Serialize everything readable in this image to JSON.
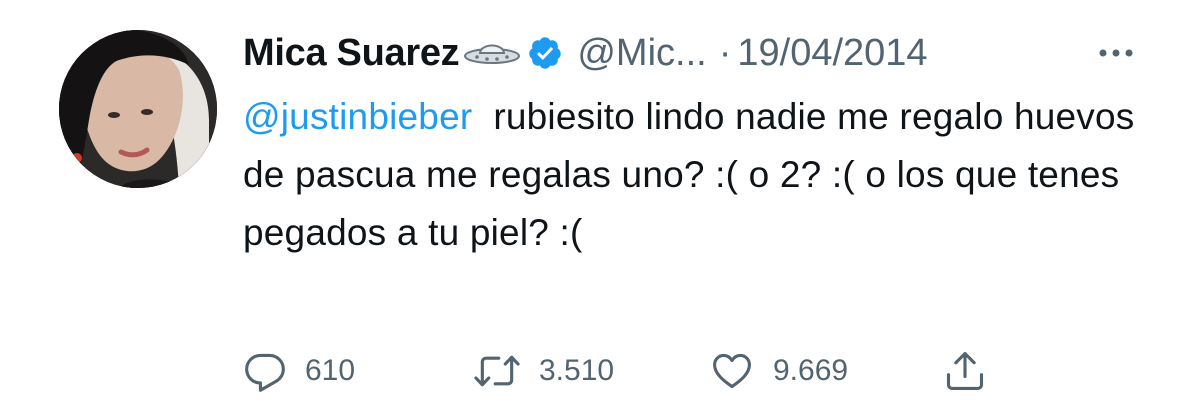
{
  "tweet": {
    "author": {
      "display_name": "Mica Suarez",
      "emoji_icon": "ufo-icon",
      "verified_icon": "verified-badge-icon",
      "handle": "@Mic...",
      "separator": "·",
      "date": "19/04/2014"
    },
    "more_icon": "more-horizontal-icon",
    "body": {
      "mention": "@justinbieber",
      "text": "  rubiesito lindo nadie me regalo huevos de pascua me regalas uno? :( o 2? :( o los que tenes pegados a tu piel? :("
    },
    "actions": {
      "reply": {
        "icon": "reply-icon",
        "count": "610"
      },
      "retweet": {
        "icon": "retweet-icon",
        "count": "3.510"
      },
      "like": {
        "icon": "heart-icon",
        "count": "9.669"
      },
      "share": {
        "icon": "share-icon"
      }
    }
  },
  "colors": {
    "link": "#1d9bf0",
    "muted": "#536471",
    "text": "#0f1419",
    "verified": "#1d9bf0"
  }
}
